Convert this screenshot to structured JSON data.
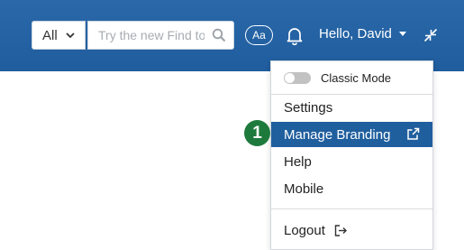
{
  "header": {
    "scope_selected": "All",
    "search_placeholder": "Try the new Find to",
    "font_size_button": "Aa",
    "greeting": "Hello, David"
  },
  "menu": {
    "classic_mode_label": "Classic Mode",
    "classic_mode_on": false,
    "items": [
      "Settings",
      "Manage Branding",
      "Help",
      "Mobile"
    ],
    "active_item": "Manage Branding",
    "logout_label": "Logout"
  },
  "callout": {
    "number": "1"
  },
  "colors": {
    "header_bg": "#2366a8",
    "active_item_bg": "#205f9e",
    "callout_bg": "#1e7a3c"
  },
  "icons": [
    "chevron-down-icon",
    "search-icon",
    "bell-icon",
    "caret-down-icon",
    "collapse-arrows-icon",
    "external-link-icon",
    "logout-icon"
  ]
}
